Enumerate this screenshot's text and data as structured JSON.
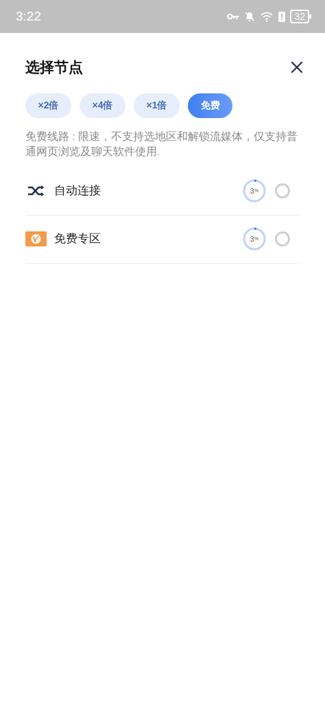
{
  "status_bar": {
    "time": "3:22",
    "battery": "32"
  },
  "title": "选择节点",
  "tabs": [
    {
      "label": "×2倍",
      "selected": false
    },
    {
      "label": "×4倍",
      "selected": false
    },
    {
      "label": "×1倍",
      "selected": false
    },
    {
      "label": "免费",
      "selected": true
    }
  ],
  "description": "免费线路 : 限速，不支持选地区和解锁流媒体，仅支持普通网页浏览及聊天软件使用.",
  "nodes": [
    {
      "kind": "auto",
      "name": "自动连接",
      "load": "3",
      "unit": "%",
      "level": 0.03,
      "selected": false
    },
    {
      "kind": "free",
      "name": "免费专区",
      "load": "3",
      "unit": "%",
      "level": 0.03,
      "selected": false
    }
  ]
}
